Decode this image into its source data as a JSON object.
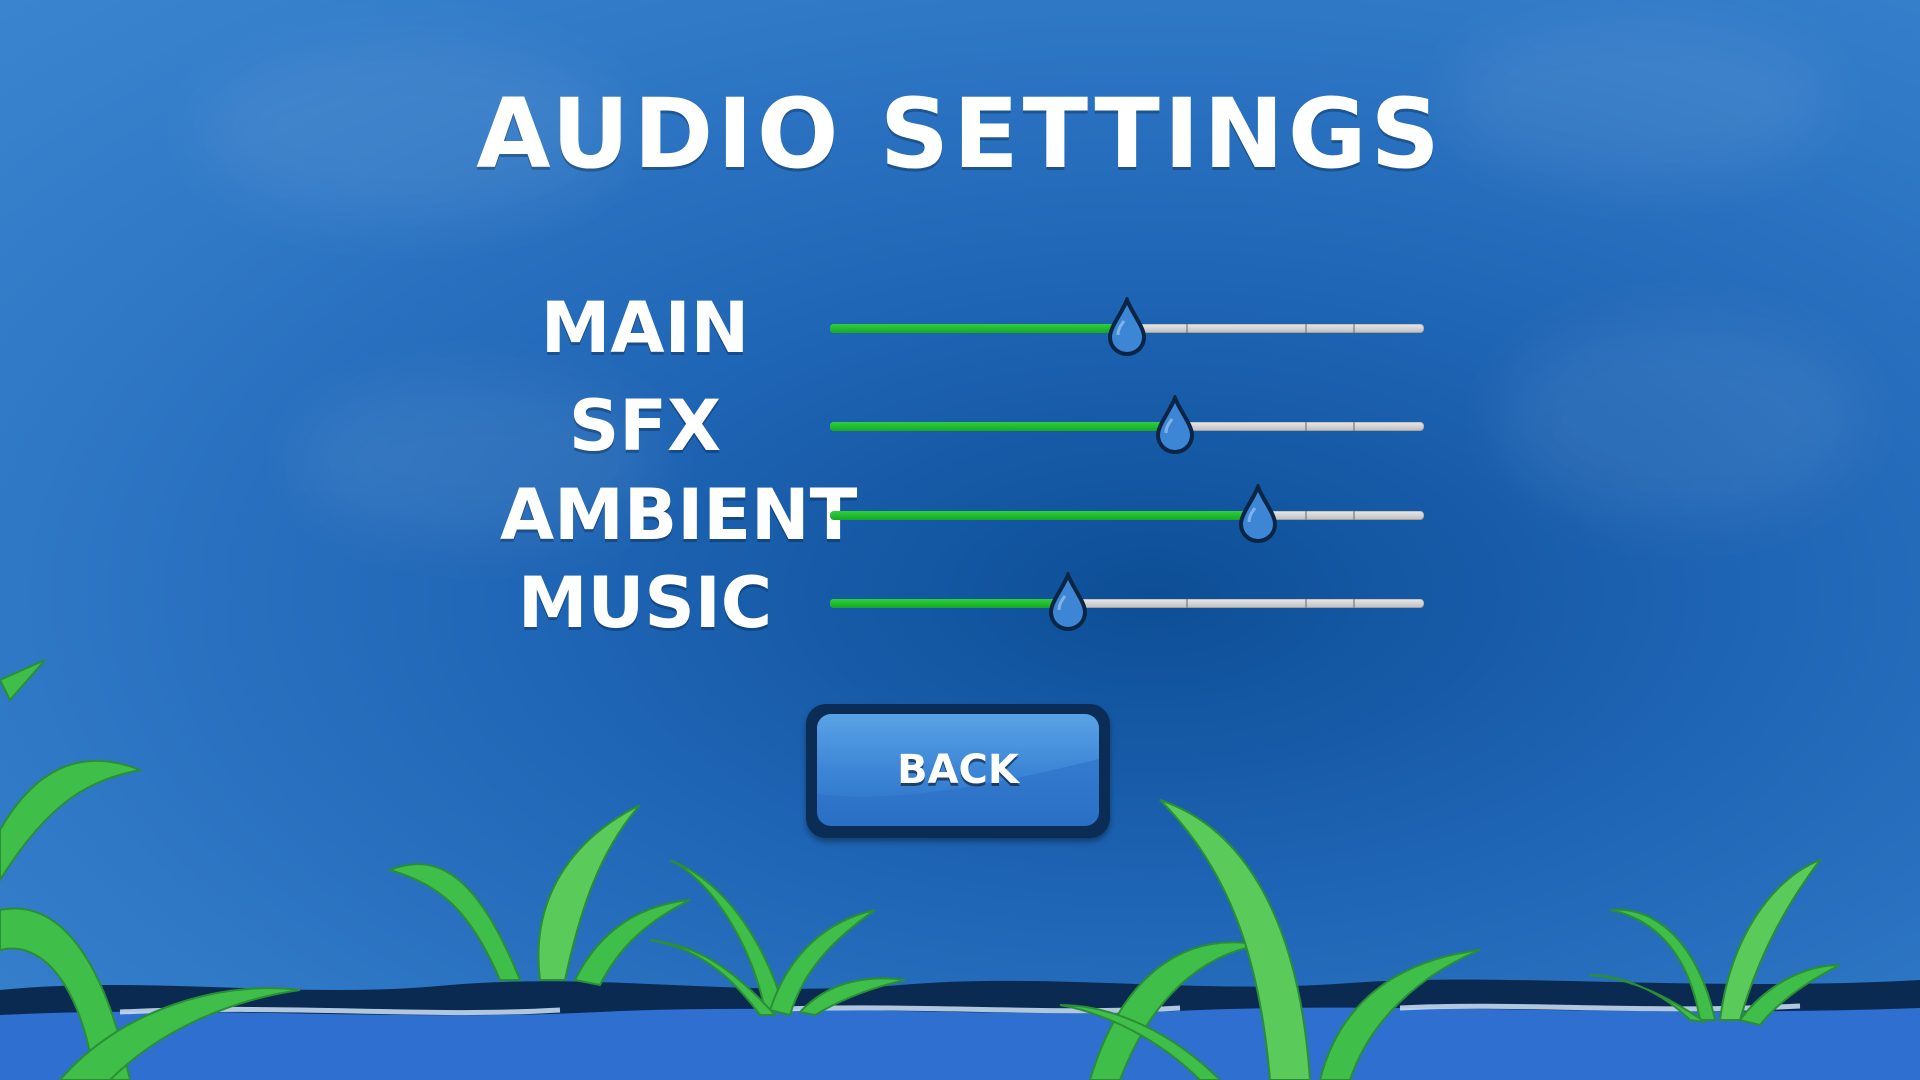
{
  "title": "AUDIO SETTINGS",
  "sliders": [
    {
      "label": "MAIN",
      "value": 0.5
    },
    {
      "label": "SFX",
      "value": 0.58
    },
    {
      "label": "AMBIENT",
      "value": 0.72
    },
    {
      "label": "MUSIC",
      "value": 0.4
    }
  ],
  "back_button": {
    "label": "BACK"
  },
  "colors": {
    "fill": "#17a826",
    "track": "#cfcfcf",
    "handle": "#3d86d6",
    "button": "#3d86d6",
    "plants": "#3fbf4a"
  }
}
